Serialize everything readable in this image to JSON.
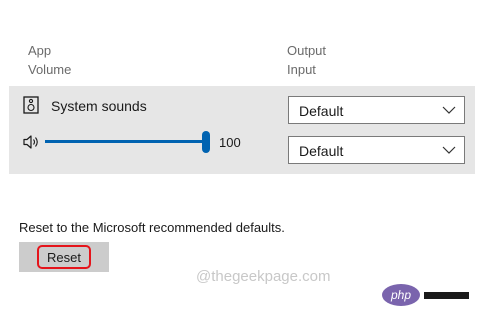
{
  "headers": {
    "app": "App",
    "volume": "Volume",
    "output": "Output",
    "input": "Input"
  },
  "app_row": {
    "icon": "speaker-device-icon",
    "name": "System sounds",
    "volume_icon": "volume-icon",
    "volume_value": "100",
    "volume_level": 100,
    "output_device": "Default",
    "input_device": "Default"
  },
  "reset": {
    "description": "Reset to the Microsoft recommended defaults.",
    "button_label": "Reset"
  },
  "watermark": {
    "text": "@thegeekpage.com",
    "logo_text": "php"
  },
  "colors": {
    "accent": "#0063b1",
    "highlight": "#e5141b",
    "panel": "#e6e6e6"
  }
}
